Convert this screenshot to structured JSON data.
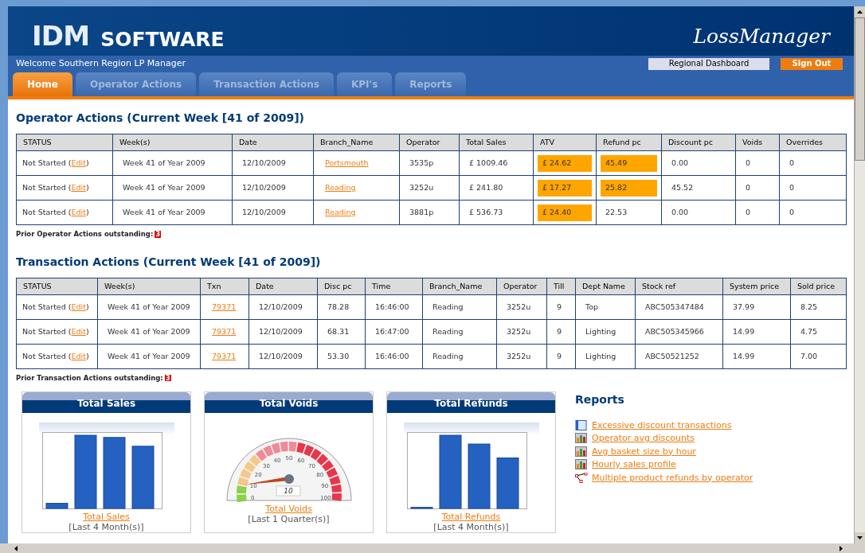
{
  "header": {
    "logo_main": "IDM",
    "logo_sub": "SOFTWARE",
    "product": "LossManager",
    "welcome": "Welcome Southern Region LP Manager",
    "buttons": [
      {
        "label": "Regional Dashboard",
        "kind": "plain"
      },
      {
        "label": "Sign Out",
        "kind": "accent"
      }
    ]
  },
  "tabs": [
    {
      "label": "Home",
      "selected": true
    },
    {
      "label": "Operator Actions",
      "selected": false
    },
    {
      "label": "Transaction Actions",
      "selected": false
    },
    {
      "label": "KPI's",
      "selected": false
    },
    {
      "label": "Reports",
      "selected": false
    }
  ],
  "operator_actions": {
    "title": "Operator Actions (Current Week [41 of 2009])",
    "columns": [
      "STATUS",
      "Week(s)",
      "Date",
      "Branch_Name",
      "Operator",
      "Total Sales",
      "ATV",
      "Refund pc",
      "Discount pc",
      "Voids",
      "Overrides"
    ],
    "rows": [
      {
        "status": "Not Started (",
        "action": "Edit",
        "status_end": ")",
        "week": "Week 41 of Year 2009",
        "date": "12/10/2009",
        "branch": "Portsmouth",
        "operator": "3535p",
        "total_sales": "£ 1009.46",
        "atv": "£ 24.62",
        "atv_flagged": true,
        "refund_pc": "45.49",
        "refund_flagged": true,
        "discount_pc": "0.00",
        "voids": "0",
        "overrides": "0"
      },
      {
        "status": "Not Started (",
        "action": "Edit",
        "status_end": ")",
        "week": "Week 41 of Year 2009",
        "date": "12/10/2009",
        "branch": "Reading",
        "operator": "3252u",
        "total_sales": "£ 241.80",
        "atv": "£ 17.27",
        "atv_flagged": true,
        "refund_pc": "25.82",
        "refund_flagged": true,
        "discount_pc": "45.52",
        "voids": "0",
        "overrides": "0"
      },
      {
        "status": "Not Started (",
        "action": "Edit",
        "status_end": ")",
        "week": "Week 41 of Year 2009",
        "date": "12/10/2009",
        "branch": "Reading",
        "operator": "3881p",
        "total_sales": "£ 536.73",
        "atv": "£ 24.40",
        "atv_flagged": true,
        "refund_pc": "22.53",
        "refund_flagged": false,
        "discount_pc": "0.00",
        "voids": "0",
        "overrides": "0"
      }
    ],
    "prior_label": "Prior Operator Actions outstanding:",
    "prior_count": "3"
  },
  "transaction_actions": {
    "title": "Transaction Actions (Current Week [41 of 2009])",
    "columns": [
      "STATUS",
      "Week(s)",
      "Txn",
      "Date",
      "Disc pc",
      "Time",
      "Branch_Name",
      "Operator",
      "Till",
      "Dept Name",
      "Stock ref",
      "System price",
      "Sold price"
    ],
    "rows": [
      {
        "status": "Not Started (",
        "action": "Edit",
        "status_end": ")",
        "week": "Week 41 of Year 2009",
        "txn": "79371",
        "date": "12/10/2009",
        "disc_pc": "78.28",
        "time": "16:46:00",
        "branch": "Reading",
        "operator": "3252u",
        "till": "9",
        "dept": "Top",
        "stock_ref": "ABC505347484",
        "system_price": "37.99",
        "sold_price": "8.25"
      },
      {
        "status": "Not Started (",
        "action": "Edit",
        "status_end": ")",
        "week": "Week 41 of Year 2009",
        "txn": "79371",
        "date": "12/10/2009",
        "disc_pc": "68.31",
        "time": "16:47:00",
        "branch": "Reading",
        "operator": "3252u",
        "till": "9",
        "dept": "Lighting",
        "stock_ref": "ABC505345966",
        "system_price": "14.99",
        "sold_price": "4.75"
      },
      {
        "status": "Not Started (",
        "action": "Edit",
        "status_end": ")",
        "week": "Week 41 of Year 2009",
        "txn": "79371",
        "date": "12/10/2009",
        "disc_pc": "53.30",
        "time": "16:46:00",
        "branch": "Reading",
        "operator": "3252u",
        "till": "9",
        "dept": "Lighting",
        "stock_ref": "ABC50521252",
        "system_price": "14.99",
        "sold_price": "7.00"
      }
    ],
    "prior_label": "Prior Transaction Actions outstanding:",
    "prior_count": "3"
  },
  "widgets": [
    {
      "title": "Total Sales",
      "kind": "bars",
      "link": "Total Sales",
      "period": "[Last 4 Month(s)]"
    },
    {
      "title": "Total Voids",
      "kind": "gauge",
      "gauge_labels": [
        "0",
        "10",
        "20",
        "30",
        "40",
        "50",
        "60",
        "70",
        "80",
        "90",
        "100"
      ],
      "value": "10",
      "link": "Total Voids",
      "period": "[Last 1 Quarter(s)]"
    },
    {
      "title": "Total Refunds",
      "kind": "bars",
      "link": "Total Refunds",
      "period": "[Last 4 Month(s)]"
    }
  ],
  "reports": {
    "title": "Reports",
    "items": [
      {
        "label": "Excessive discount transactions",
        "kind": "table"
      },
      {
        "label": "Operator avg discounts",
        "kind": "chart"
      },
      {
        "label": "Avg basket size by hour",
        "kind": "chart"
      },
      {
        "label": "Hourly sales profile",
        "kind": "chart"
      },
      {
        "label": "Multiple product refunds by operator",
        "kind": "network"
      }
    ]
  }
}
